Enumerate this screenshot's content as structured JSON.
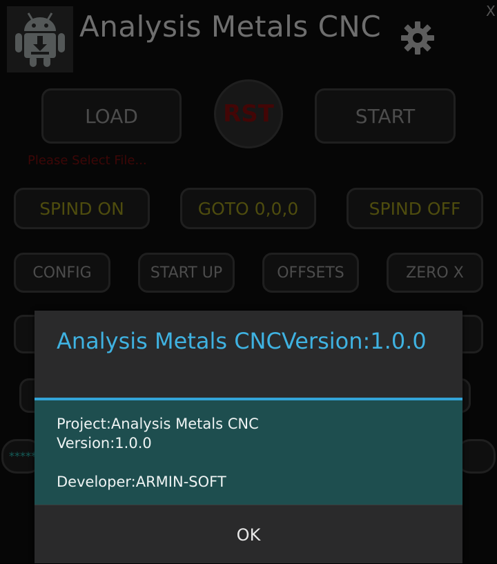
{
  "header": {
    "app_title": "Analysis Metals CNC",
    "settings_icon": "gear-icon",
    "close_label": "X"
  },
  "controls": {
    "load": "LOAD",
    "reset": "RST",
    "start": "START",
    "status": "Please Select File...",
    "spind_on": "SPIND ON",
    "goto": "GOTO  0,0,0",
    "spind_off": "SPIND OFF",
    "config": "CONFIG",
    "start_up": "START UP",
    "offsets": "OFFSETS",
    "zero_x": "ZERO X",
    "partial_text": "*****"
  },
  "colors": {
    "accent": "#33a4d8",
    "dialog_body": "#1e4e4f",
    "reset_text": "#7a0b0b",
    "status_text": "#6f0c0c",
    "yellow_button_text": "#8e8a1a"
  },
  "dialog": {
    "title": "Analysis Metals CNCVersion:1.0.0",
    "project_line": "Project:Analysis Metals CNC",
    "version_line": "Version:1.0.0",
    "developer_line": "Developer:ARMIN-SOFT",
    "ok_label": "OK"
  }
}
